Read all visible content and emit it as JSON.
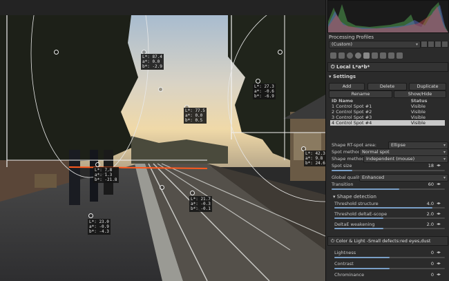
{
  "panel": {
    "processing_profiles_label": "Processing Profiles",
    "profile_value": "(Custom)",
    "tool_title": "Local L*a*b*",
    "settings_label": "Settings",
    "buttons": {
      "add": "Add",
      "delete": "Delete",
      "duplicate": "Duplicate",
      "rename": "Rename",
      "showhide": "Show/Hide"
    },
    "spots_headers": {
      "id_name": "ID Name",
      "status": "Status"
    },
    "spots": [
      {
        "id": "1",
        "name": "Control Spot #1",
        "status": "Visible"
      },
      {
        "id": "2",
        "name": "Control Spot #2",
        "status": "Visible"
      },
      {
        "id": "3",
        "name": "Control Spot #3",
        "status": "Visible"
      },
      {
        "id": "4",
        "name": "Control Spot #4",
        "status": "Visible"
      }
    ],
    "shape_rt_label": "Shape RT-spot area:",
    "shape_rt_value": "Ellipse",
    "spot_method_label": "Spot method",
    "spot_method_value": "Normal spot",
    "shape_method_label": "Shape method",
    "shape_method_value": "Independent (mouse)",
    "spot_size_label": "Spot size",
    "spot_size_value": "18",
    "global_quality_label": "Global quality:",
    "global_quality_value": "Enhanced",
    "transition_label": "Transition",
    "transition_value": "60",
    "shape_detection_label": "Shape detection",
    "threshold_structure_label": "Threshold structure",
    "threshold_structure_value": "4.0",
    "threshold_deltae_label": "Threshold deltaE-scope",
    "threshold_deltae_value": "2.0",
    "deltae_weakening_label": "DeltaE weakening",
    "deltae_weakening_value": "2.0",
    "color_light_label": "Color & Light -Small defects:red eyes,dust",
    "lightness_label": "Lightness",
    "lightness_value": "0",
    "contrast_label": "Contrast",
    "contrast_value": "0",
    "chrominance_label": "Chrominance",
    "chrominance_value": "0"
  },
  "readouts": [
    {
      "l": "L*: 87.4",
      "a": "a*: 0.0",
      "b": "b*: -2.9"
    },
    {
      "l": "L*: 27.3",
      "a": "a*: -0.6",
      "b": "b*: -6.9"
    },
    {
      "l": "L*: 77.5",
      "a": "a*: 0.0",
      "b": "b*: 0.5"
    },
    {
      "l": "L*: 42.3",
      "a": "a*: 9.8",
      "b": "b*: 24.6"
    },
    {
      "l": "L*: 7.8",
      "a": "a*: 1.3",
      "b": "b*: -21.8"
    },
    {
      "l": "L*: 21.7",
      "a": "a*: -0.3",
      "b": "b*: -0.1"
    },
    {
      "l": "L*: 23.0",
      "a": "a*: -0.9",
      "b": "b*: -4.3"
    }
  ],
  "colors": {
    "accent": "#7aa0c8",
    "selection": "#c8c8c8",
    "panel_bg": "#2b2b2b",
    "spot_line": "#ff5a1e"
  }
}
